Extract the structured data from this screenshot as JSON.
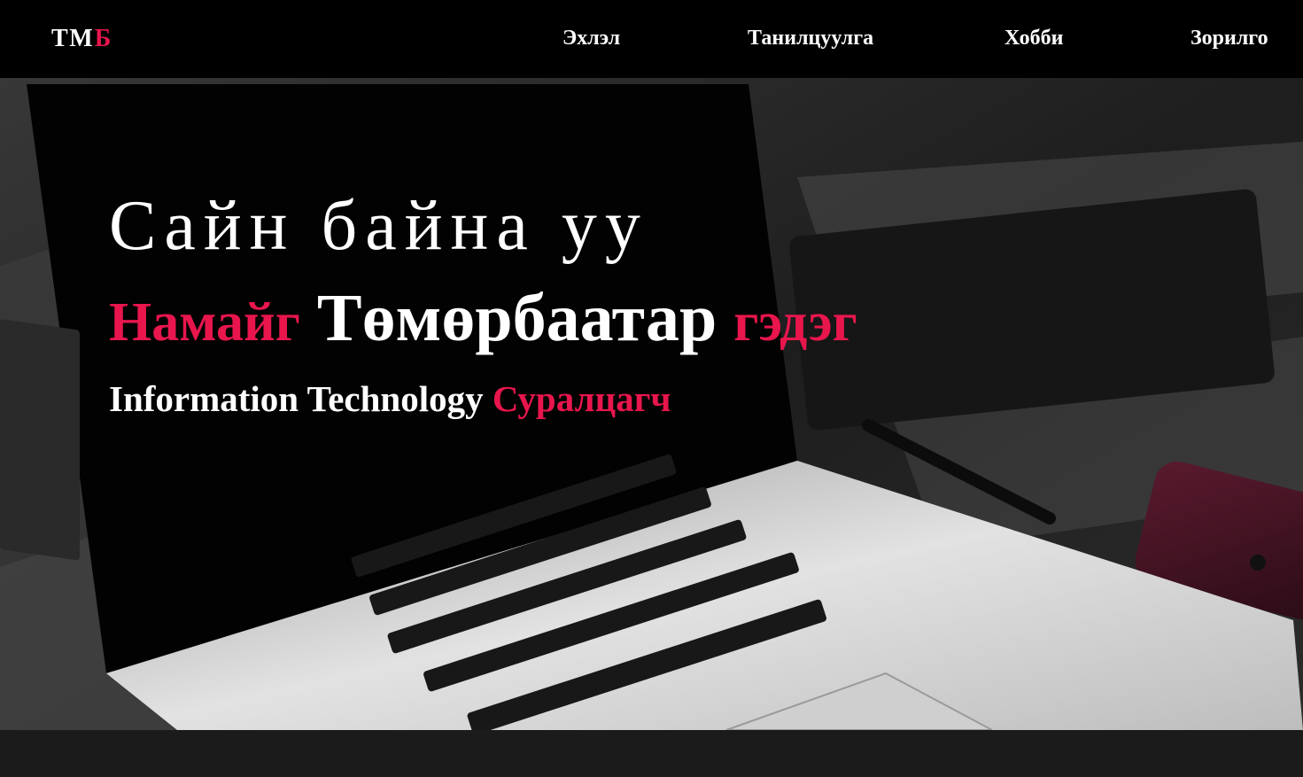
{
  "logo": {
    "main": "ТМ",
    "accent": "Б"
  },
  "nav": {
    "home": "Эхлэл",
    "about": "Танилцуулга",
    "hobby": "Хобби",
    "goal": "Зорилго"
  },
  "hero": {
    "greeting": "Сайн байна уу",
    "intro_prefix": "Намайг",
    "name": "Төмөрбаатар",
    "intro_suffix": "гэдэг",
    "role_main": "Information Technology",
    "role_accent": "Суралцагч"
  },
  "colors": {
    "accent": "#e8164d",
    "nav_bg": "#000000",
    "text": "#ffffff",
    "footer_bg": "#1b1b1b"
  },
  "icons": {
    "background": "laptop-photo"
  }
}
